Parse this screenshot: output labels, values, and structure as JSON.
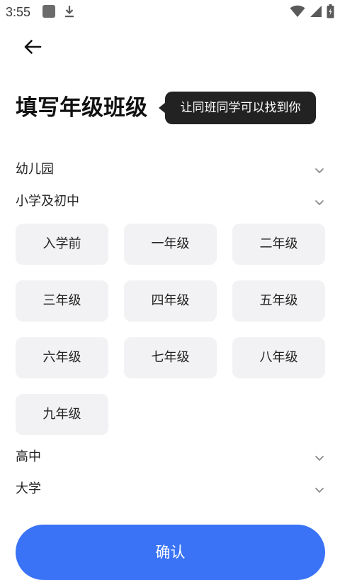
{
  "status_bar": {
    "time": "3:55",
    "icons": [
      "app-icon",
      "download-icon",
      "wifi-icon",
      "signal-icon",
      "battery-icon"
    ]
  },
  "header": {
    "back_icon": "arrow-left-icon",
    "title": "填写年级班级",
    "tooltip": "让同班同学可以找到你"
  },
  "categories": [
    {
      "label": "幼儿园",
      "expanded": false
    },
    {
      "label": "小学及初中",
      "expanded": true
    },
    {
      "label": "高中",
      "expanded": false
    },
    {
      "label": "大学",
      "expanded": false
    }
  ],
  "grades": [
    "入学前",
    "一年级",
    "二年级",
    "三年级",
    "四年级",
    "五年级",
    "六年级",
    "七年级",
    "八年级",
    "九年级"
  ],
  "confirm_label": "确认",
  "colors": {
    "accent": "#3a73f6",
    "tooltip_bg": "#222222",
    "chip_bg": "#f2f2f4"
  }
}
